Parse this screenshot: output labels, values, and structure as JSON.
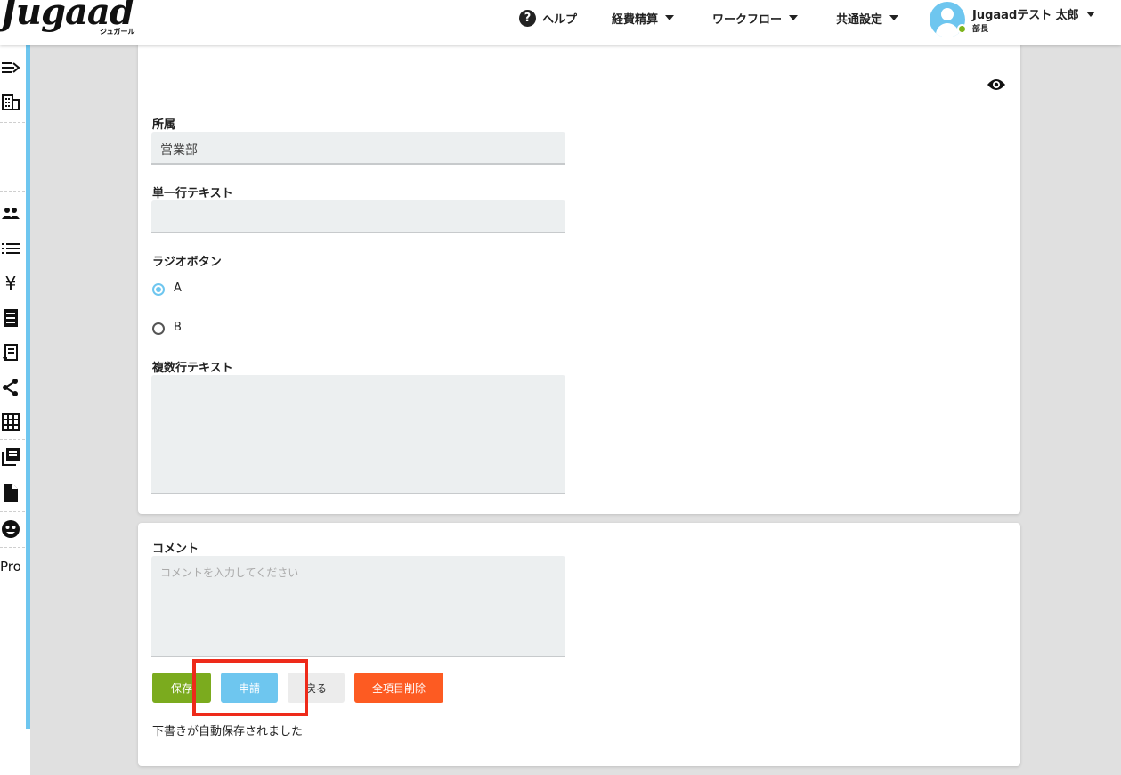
{
  "header": {
    "logo": "Jugaad",
    "logo_sub": "ジュガール",
    "nav": {
      "help": "ヘルプ",
      "expenses": "経費精算",
      "workflow": "ワークフロー",
      "common_settings": "共通設定"
    },
    "user": {
      "name": "Jugaadテスト 太郎",
      "role": "部長"
    }
  },
  "sidebar": {
    "icons": [
      "logout-icon",
      "building-icon",
      "people-icon",
      "list-icon",
      "yen-icon",
      "receipt-icon",
      "document-icon",
      "share-icon",
      "grid-icon",
      "library-icon",
      "file-icon",
      "emoji-icon"
    ],
    "text": "Pro"
  },
  "form": {
    "fields": {
      "department_label": "所属",
      "department_value": "営業部",
      "single_line_label": "単一行テキスト",
      "single_line_value": "",
      "radio_label": "ラジオボタン",
      "radio_options": [
        "A",
        "B"
      ],
      "radio_selected": "A",
      "multi_line_label": "複数行テキスト",
      "multi_line_value": ""
    }
  },
  "comment": {
    "label": "コメント",
    "placeholder": "コメントを入力してください",
    "buttons": {
      "save": "保存",
      "apply": "申請",
      "back": "戻る",
      "clear_all": "全項目削除"
    },
    "status": "下書きが自動保存されました"
  },
  "colors": {
    "accent_blue": "#6ec6ef",
    "save_green": "#7bab1e",
    "clear_orange": "#fd5b22",
    "highlight_red": "#ee2a1a"
  }
}
